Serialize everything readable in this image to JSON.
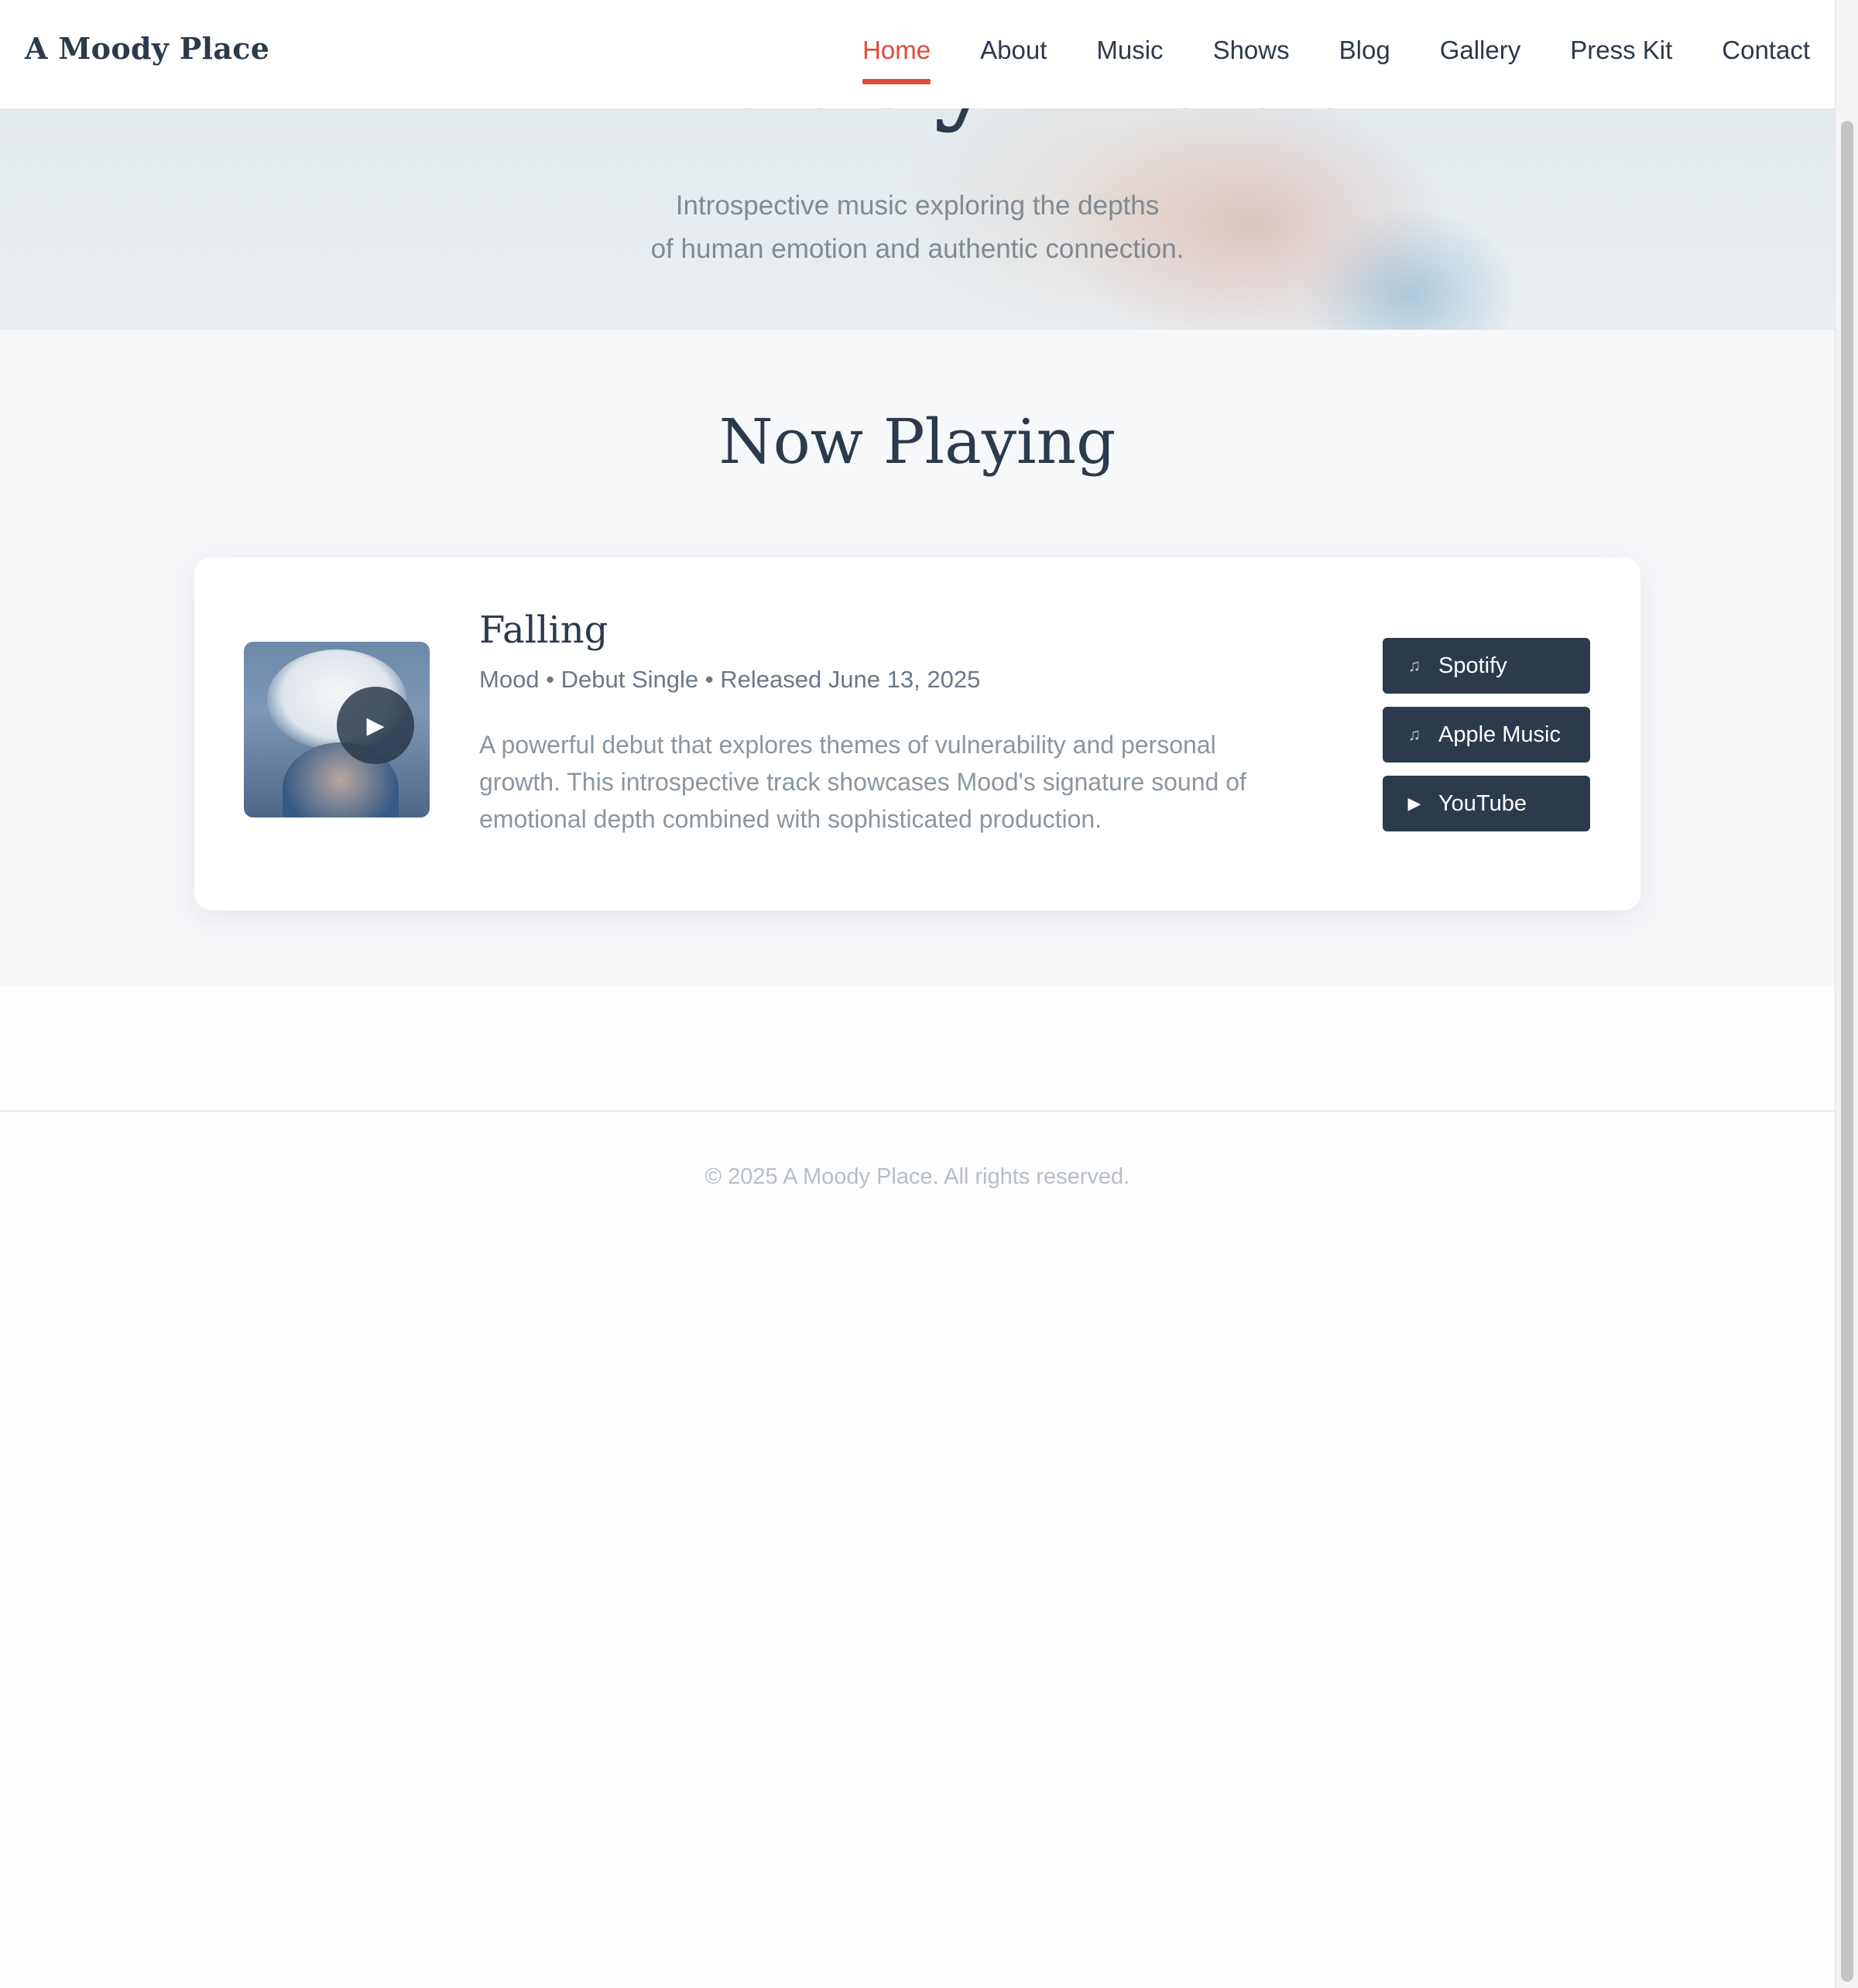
{
  "brand": {
    "logo": "A Moody Place"
  },
  "nav": {
    "items": [
      {
        "label": "Home",
        "active": true
      },
      {
        "label": "About"
      },
      {
        "label": "Music"
      },
      {
        "label": "Shows"
      },
      {
        "label": "Blog"
      },
      {
        "label": "Gallery"
      },
      {
        "label": "Press Kit"
      },
      {
        "label": "Contact"
      }
    ],
    "active_color": "#e04a3a"
  },
  "hero": {
    "title": "A Moody Place",
    "subtitle_line1": "Introspective music exploring the depths",
    "subtitle_line2": "of human emotion and authentic connection."
  },
  "now_playing": {
    "heading": "Now Playing",
    "track": {
      "title": "Falling",
      "meta": "Mood • Debut Single • Released June 13, 2025",
      "description": "A powerful debut that explores themes of vulnerability and personal growth. This introspective track showcases Mood's signature sound of emotional depth combined with sophisticated production.",
      "play_icon": "play-icon"
    },
    "streaming": [
      {
        "label": "Spotify",
        "icon": "music-note-icon"
      },
      {
        "label": "Apple Music",
        "icon": "music-note-icon"
      },
      {
        "label": "YouTube",
        "icon": "play-icon"
      }
    ]
  },
  "footer": {
    "copyright": "© 2025 A Moody Place. All rights reserved."
  },
  "colors": {
    "primary": "#2c3a4b",
    "accent": "#e04a3a",
    "section_bg": "#f7f8fa"
  }
}
